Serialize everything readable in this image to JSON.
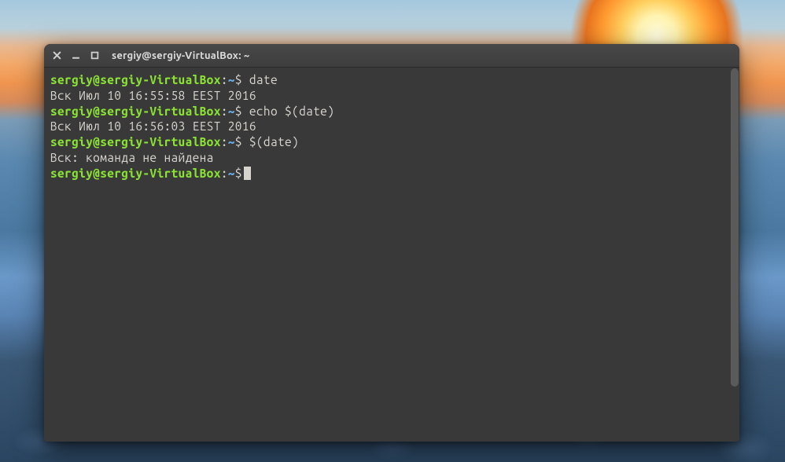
{
  "window": {
    "title": "sergiy@sergiy-VirtualBox: ~"
  },
  "prompt": {
    "user_host": "sergiy@sergiy-VirtualBox",
    "separator": ":",
    "path": "~",
    "symbol": "$"
  },
  "lines": {
    "cmd1": " date",
    "out1": "Вск Июл 10 16:55:58 EEST 2016",
    "cmd2": " echo $(date)",
    "out2": "Вск Июл 10 16:56:03 EEST 2016",
    "cmd3": " $(date)",
    "out3": "Вск: команда не найдена"
  }
}
